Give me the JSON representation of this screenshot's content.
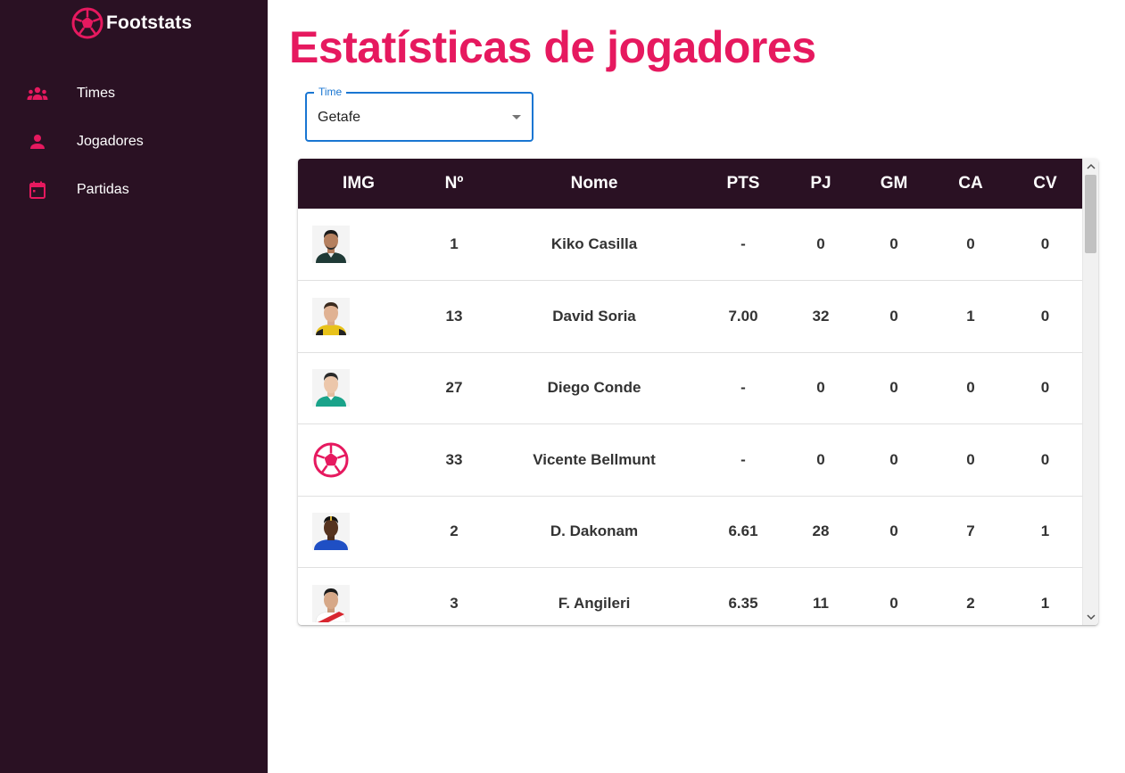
{
  "brand": {
    "name": "Footstats",
    "logo_icon": "soccer-ball-icon",
    "accent": "#e6195f"
  },
  "sidebar": {
    "items": [
      {
        "label": "Times",
        "icon": "groups-icon"
      },
      {
        "label": "Jogadores",
        "icon": "person-icon"
      },
      {
        "label": "Partidas",
        "icon": "calendar-icon"
      }
    ]
  },
  "page": {
    "title": "Estatísticas de jogadores"
  },
  "team_select": {
    "label": "Time",
    "value": "Getafe"
  },
  "table": {
    "headers": [
      "IMG",
      "Nº",
      "Nome",
      "PTS",
      "PJ",
      "GM",
      "CA",
      "CV"
    ],
    "rows": [
      {
        "img": "player-photo",
        "number": "1",
        "name": "Kiko Casilla",
        "pts": "-",
        "pj": "0",
        "gm": "0",
        "ca": "0",
        "cv": "0"
      },
      {
        "img": "player-photo",
        "number": "13",
        "name": "David Soria",
        "pts": "7.00",
        "pj": "32",
        "gm": "0",
        "ca": "1",
        "cv": "0"
      },
      {
        "img": "player-photo",
        "number": "27",
        "name": "Diego Conde",
        "pts": "-",
        "pj": "0",
        "gm": "0",
        "ca": "0",
        "cv": "0"
      },
      {
        "img": "soccer-ball-placeholder",
        "number": "33",
        "name": "Vicente Bellmunt",
        "pts": "-",
        "pj": "0",
        "gm": "0",
        "ca": "0",
        "cv": "0"
      },
      {
        "img": "player-photo",
        "number": "2",
        "name": "D. Dakonam",
        "pts": "6.61",
        "pj": "28",
        "gm": "0",
        "ca": "7",
        "cv": "1"
      },
      {
        "img": "player-photo",
        "number": "3",
        "name": "F. Angileri",
        "pts": "6.35",
        "pj": "11",
        "gm": "0",
        "ca": "2",
        "cv": "1"
      }
    ]
  }
}
